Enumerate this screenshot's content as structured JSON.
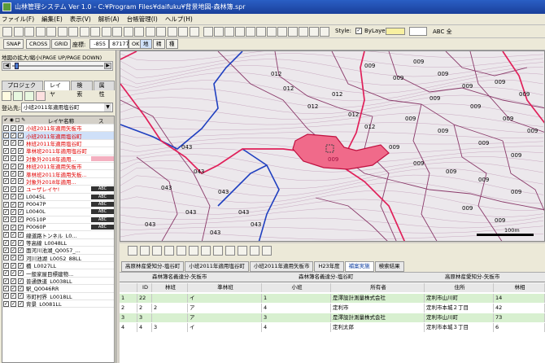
{
  "window": {
    "title": "山林管理システム Ver 1.0 - C:¥Program Files¥daifuku¥背景地図-森林簿.spr"
  },
  "menu": [
    "ファイル(F)",
    "編集(E)",
    "表示(V)",
    "解析(A)",
    "台帳管理(I)",
    "ヘルプ(H)"
  ],
  "toolbar2": {
    "snap": "SNAP",
    "cross": "CROSS",
    "grid": "GRID",
    "coord_label": "座標:",
    "x": "-855",
    "y": "87177",
    "ok": "OK",
    "b1": "地",
    "b2": "精",
    "b3": "種"
  },
  "style": {
    "label": "Style:",
    "bylayer": "ByLayer",
    "abc": "ABC 全"
  },
  "left": {
    "zoom_label": "地図の拡大/縮小(PAGE UP/PAGE DOWN)",
    "tabs": [
      "プロジェクト",
      "レイヤ",
      "検索",
      "属性"
    ],
    "target_label": "登込先:",
    "target_value": "小班2011年適用塩谷町",
    "header_name": "レイヤ名称",
    "header_s": "ス",
    "layers": [
      {
        "name": "小班2011年適用矢板市",
        "color": "#e00000",
        "sym": "none"
      },
      {
        "name": "小班2011年適用塩谷町",
        "color": "#e00000",
        "sym": "none",
        "sel": true
      },
      {
        "name": "林班2011年適用塩谷町",
        "color": "#e00000",
        "sym": "none"
      },
      {
        "name": "準林班2011年適用塩谷町",
        "color": "#e00000",
        "sym": "none"
      },
      {
        "name": "対象外2018年適用...",
        "color": "#e00000",
        "sym": "pink"
      },
      {
        "name": "林班2011年適用矢板市",
        "color": "#e00000",
        "sym": "none"
      },
      {
        "name": "準林班2011年適用矢板...",
        "color": "#e00000",
        "sym": "none"
      },
      {
        "name": "対象外2018年適用...",
        "color": "#e00000",
        "sym": "none"
      },
      {
        "name": "ユーザレイヤ!",
        "color": "#e00000",
        "sym": "abc"
      },
      {
        "name": "L0045L",
        "color": "#000000",
        "sym": "abc"
      },
      {
        "name": "P0047P",
        "color": "#000000",
        "sym": "abc"
      },
      {
        "name": "L0040L",
        "color": "#000000",
        "sym": "abc"
      },
      {
        "name": "P0510P",
        "color": "#000000",
        "sym": "abc"
      },
      {
        "name": "P0060P",
        "color": "#000000",
        "sym": "abc"
      },
      {
        "name": "線道路トンネル_L0...",
        "color": "#000000",
        "sym": "none"
      },
      {
        "name": "等高線_L0048LL",
        "color": "#000000",
        "sym": "none"
      },
      {
        "name": "面河川池湖_Q0057_...",
        "color": "#000000",
        "sym": "none"
      },
      {
        "name": "河川池湖_L0052_88LL",
        "color": "#000000",
        "sym": "none"
      },
      {
        "name": "橋_L0027LL",
        "color": "#000000",
        "sym": "none"
      },
      {
        "name": "一般家屋目標建物...",
        "color": "#000000",
        "sym": "none"
      },
      {
        "name": "普通鉄道_L0038LL",
        "color": "#000000",
        "sym": "none"
      },
      {
        "name": "駅_Q0046RR",
        "color": "#000000",
        "sym": "none"
      },
      {
        "name": "市町村界_L0018LL",
        "color": "#000000",
        "sym": "none"
      },
      {
        "name": "背景_L0081LL",
        "color": "#000000",
        "sym": "none"
      }
    ]
  },
  "map": {
    "labels": [
      {
        "t": "012",
        "sel": false
      },
      {
        "t": "009",
        "sel": false
      },
      {
        "t": "009",
        "sel": false
      },
      {
        "t": "009",
        "sel": false
      },
      {
        "t": "009",
        "sel": false
      },
      {
        "t": "009",
        "sel": false
      },
      {
        "t": "009",
        "sel": false
      },
      {
        "t": "009",
        "sel": false
      },
      {
        "t": "009",
        "sel": false
      },
      {
        "t": "009",
        "sel": false
      },
      {
        "t": "009",
        "sel": false
      },
      {
        "t": "009",
        "sel": false
      },
      {
        "t": "009",
        "sel": false
      },
      {
        "t": "009",
        "sel": false
      },
      {
        "t": "009",
        "sel": false
      },
      {
        "t": "009",
        "sel": false
      },
      {
        "t": "009",
        "sel": false
      },
      {
        "t": "009",
        "sel": false
      },
      {
        "t": "009",
        "sel": false
      },
      {
        "t": "009",
        "sel": false
      },
      {
        "t": "009",
        "sel": false
      },
      {
        "t": "009",
        "sel": false
      },
      {
        "t": "009",
        "sel": false
      },
      {
        "t": "012",
        "sel": false
      },
      {
        "t": "012",
        "sel": false
      },
      {
        "t": "012",
        "sel": false
      },
      {
        "t": "012",
        "sel": false
      },
      {
        "t": "012",
        "sel": false
      },
      {
        "t": "043",
        "sel": false
      },
      {
        "t": "043",
        "sel": false
      },
      {
        "t": "043",
        "sel": false
      },
      {
        "t": "043",
        "sel": false
      },
      {
        "t": "043",
        "sel": false
      },
      {
        "t": "043",
        "sel": false
      },
      {
        "t": "043",
        "sel": false
      },
      {
        "t": "043",
        "sel": false
      },
      {
        "t": "043",
        "sel": false
      },
      {
        "t": "009",
        "sel": true
      }
    ],
    "scale": "100m",
    "colors": {
      "red_boundary": "#e0205a",
      "blue_boundary": "#2040c0",
      "parcel": "#8a3a6a",
      "selected_fill": "#f06a8a"
    }
  },
  "attr": {
    "sheets": [
      "高原林産愛知分-塩谷町",
      "小班2011年適用塩谷町",
      "小班2011年適用矢板市",
      "H23年度",
      "補案実施",
      "検索結果"
    ],
    "subsheets": [
      "森林簿名義達分-矢板市",
      "森林簿名義達分-塩谷町",
      "高原林産愛知分-矢板市"
    ],
    "headers": [
      "",
      "ID",
      "林班",
      "準林班",
      "小班",
      "所有者",
      "住所",
      "林相"
    ],
    "rows": [
      [
        "1",
        "22",
        "",
        "イ",
        "1",
        "是澤設計測量株式会社",
        "定利市山川町",
        "14"
      ],
      [
        "2",
        "2",
        "2",
        "ア",
        "4",
        "定利市",
        "定利市本城２丁目",
        "42"
      ],
      [
        "3",
        "3",
        "",
        "ア",
        "3",
        "是澤設計測量株式会社",
        "定利市山川町",
        "73"
      ],
      [
        "4",
        "4",
        "3",
        "イ",
        "4",
        "定利太郎",
        "定利市本城３丁目",
        "6"
      ]
    ]
  }
}
